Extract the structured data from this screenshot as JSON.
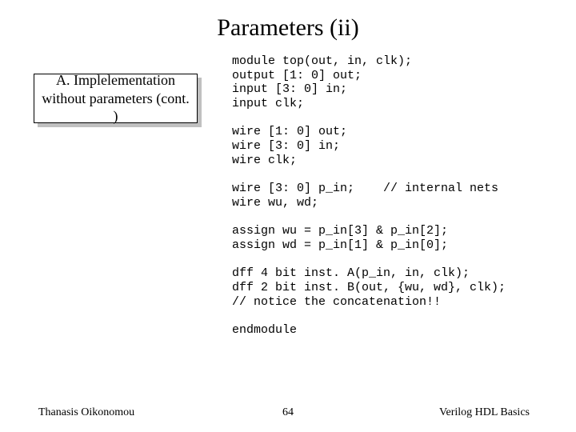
{
  "title": "Parameters (ii)",
  "callout": {
    "line1": "A. Implelementation",
    "line2": "without parameters (cont. )"
  },
  "code": "module top(out, in, clk);\noutput [1: 0] out;\ninput [3: 0] in;\ninput clk;\n\nwire [1: 0] out;\nwire [3: 0] in;\nwire clk;\n\nwire [3: 0] p_in;    // internal nets\nwire wu, wd;\n\nassign wu = p_in[3] & p_in[2];\nassign wd = p_in[1] & p_in[0];\n\ndff 4 bit inst. A(p_in, in, clk);\ndff 2 bit inst. B(out, {wu, wd}, clk);\n// notice the concatenation!!\n\nendmodule",
  "footer": {
    "left": "Thanasis Oikonomou",
    "center": "64",
    "right": "Verilog HDL Basics"
  }
}
